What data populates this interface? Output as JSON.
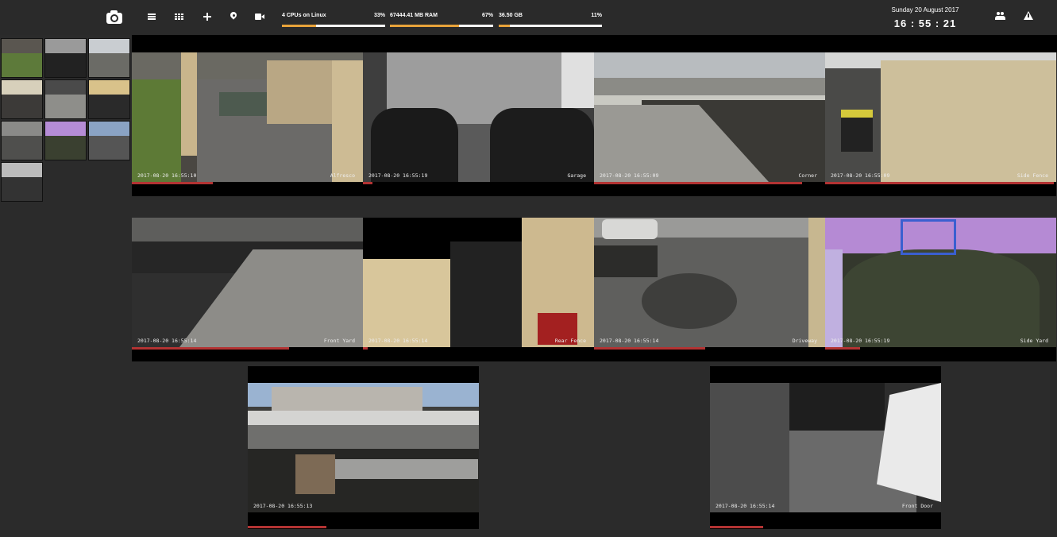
{
  "topbar": {
    "icons": [
      "camera-icon",
      "list-icon",
      "grid-icon",
      "plus-icon",
      "map-pin-icon",
      "video-icon",
      "users-icon",
      "warning-icon"
    ],
    "stats": [
      {
        "label": "4 CPUs on Linux",
        "percent": "33%",
        "fraction": 0.33
      },
      {
        "label": "67444.41 MB RAM",
        "percent": "67%",
        "fraction": 0.67
      },
      {
        "label": "36.50 GB",
        "percent": "11%",
        "fraction": 0.11
      }
    ],
    "date": "Sunday 20 August 2017",
    "time": "16 : 55 : 21"
  },
  "colors": {
    "bar_fill": "#e8a33a",
    "progress": "#b33333",
    "background": "#2b2b2b"
  },
  "cameras": [
    {
      "name": "Alfresco",
      "timestamp": "2017-08-20 16:55:10",
      "progress": 0.35
    },
    {
      "name": "Garage",
      "timestamp": "2017-08-20 16:55:19",
      "progress": 0.04
    },
    {
      "name": "Corner",
      "timestamp": "2017-08-20 16:55:09",
      "progress": 0.9
    },
    {
      "name": "Side Fence",
      "timestamp": "2017-08-20 16:55:09",
      "progress": 0.99
    },
    {
      "name": "Front Yard",
      "timestamp": "2017-08-20 16:55:14",
      "progress": 0.68
    },
    {
      "name": "Rear Fence",
      "timestamp": "2017-08-20 16:55:14",
      "progress": 0.02
    },
    {
      "name": "Driveway",
      "timestamp": "2017-08-20 16:55:14",
      "progress": 0.48
    },
    {
      "name": "Side Yard",
      "timestamp": "2017-08-20 16:55:19",
      "progress": 0.15
    },
    {
      "name": "",
      "timestamp": "2017-08-20 16:55:13",
      "progress": 0.34
    },
    {
      "name": "Front Door",
      "timestamp": "2017-08-20 16:55:14",
      "progress": 0.23
    }
  ]
}
